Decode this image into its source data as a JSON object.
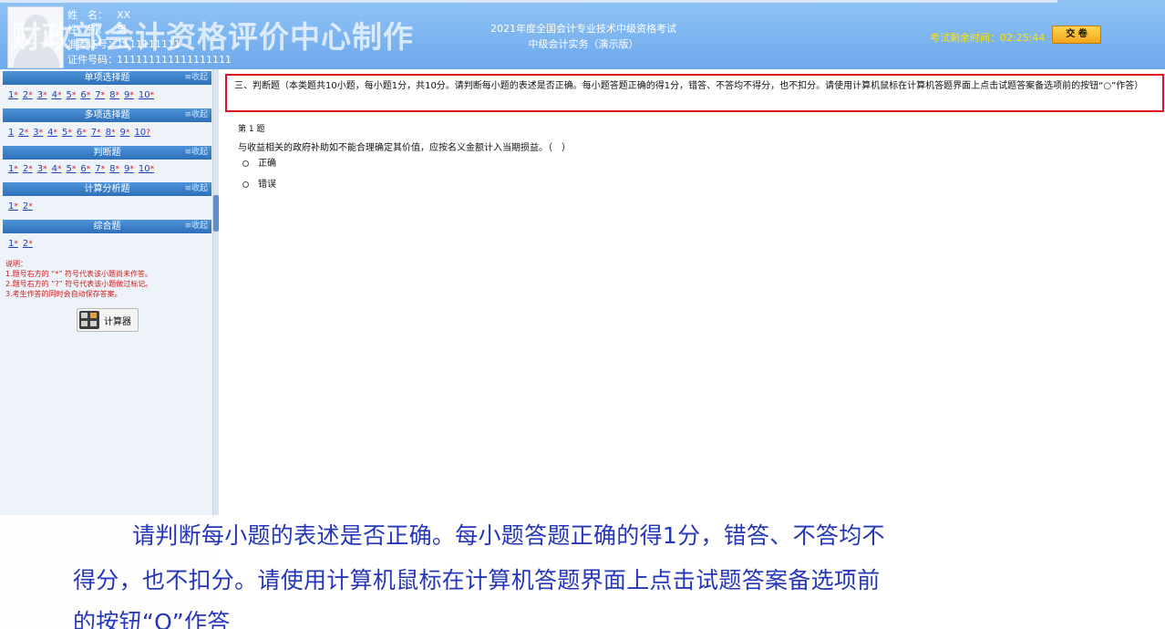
{
  "header": {
    "watermark": "财政部会计资格评价中心制作",
    "name_label": "姓　名：",
    "name_value": "XX",
    "gender_label": "性　别：",
    "gender_value": "男",
    "ticket_label": "准考证号：",
    "ticket_value": "1111111111",
    "id_label": "证件号码：",
    "id_value": "111111111111111111",
    "exam_title_1": "2021年度全国会计专业技术中级资格考试",
    "exam_title_2": "中级会计实务（演示版）",
    "timer_label": "考试剩余时间：",
    "timer_value": "02:25:44",
    "submit_label": "交 卷"
  },
  "sidebar": {
    "fold_label": "收起",
    "sections": [
      {
        "title": "单项选择题",
        "items": [
          "1",
          "2",
          "3",
          "4",
          "5",
          "6",
          "7",
          "8",
          "9",
          "10"
        ],
        "marks": [
          "*",
          "*",
          "*",
          "*",
          "*",
          "*",
          "*",
          "*",
          "*",
          "*"
        ]
      },
      {
        "title": "多项选择题",
        "items": [
          "1",
          "2",
          "3",
          "4",
          "5",
          "6",
          "7",
          "8",
          "9",
          "10"
        ],
        "marks": [
          "",
          "*",
          "*",
          "*",
          "*",
          "*",
          "*",
          "*",
          "*",
          "?"
        ]
      },
      {
        "title": "判断题",
        "items": [
          "1",
          "2",
          "3",
          "4",
          "5",
          "6",
          "7",
          "8",
          "9",
          "10"
        ],
        "marks": [
          "*",
          "*",
          "*",
          "*",
          "*",
          "*",
          "*",
          "*",
          "*",
          "*"
        ]
      },
      {
        "title": "计算分析题",
        "items": [
          "1",
          "2"
        ],
        "marks": [
          "*",
          "*"
        ]
      },
      {
        "title": "综合题",
        "items": [
          "1",
          "2"
        ],
        "marks": [
          "*",
          "*"
        ]
      }
    ],
    "notes": [
      "说明：",
      "1.题号右方的 “*” 符号代表该小题尚未作答。",
      "2.题号右方的 “?” 符号代表该小题做过标记。",
      "3.考生作答的同时会自动保存答案。"
    ],
    "calculator_label": "计算器"
  },
  "main": {
    "instructions": "三、判断题（本类题共10小题，每小题1分，共10分。请判断每小题的表述是否正确。每小题答题正确的得1分，错答、不答均不得分，也不扣分。请使用计算机鼠标在计算机答题界面上点击试题答案备选项前的按钮“○”作答）",
    "question_number": "第 1 题",
    "question_text": "与收益相关的政府补助如不能合理确定其价值，应按名义金额计入当期损益。（　）",
    "options": [
      "正确",
      "错误"
    ]
  },
  "subtitle": {
    "line1": "请判断每小题的表述是否正确。每小题答题正确的得1分，错答、不答均不",
    "line2": "得分，也不扣分。请使用计算机鼠标在计算机答题界面上点击试题答案备选项前",
    "line3": "的按钮“O”作答"
  }
}
